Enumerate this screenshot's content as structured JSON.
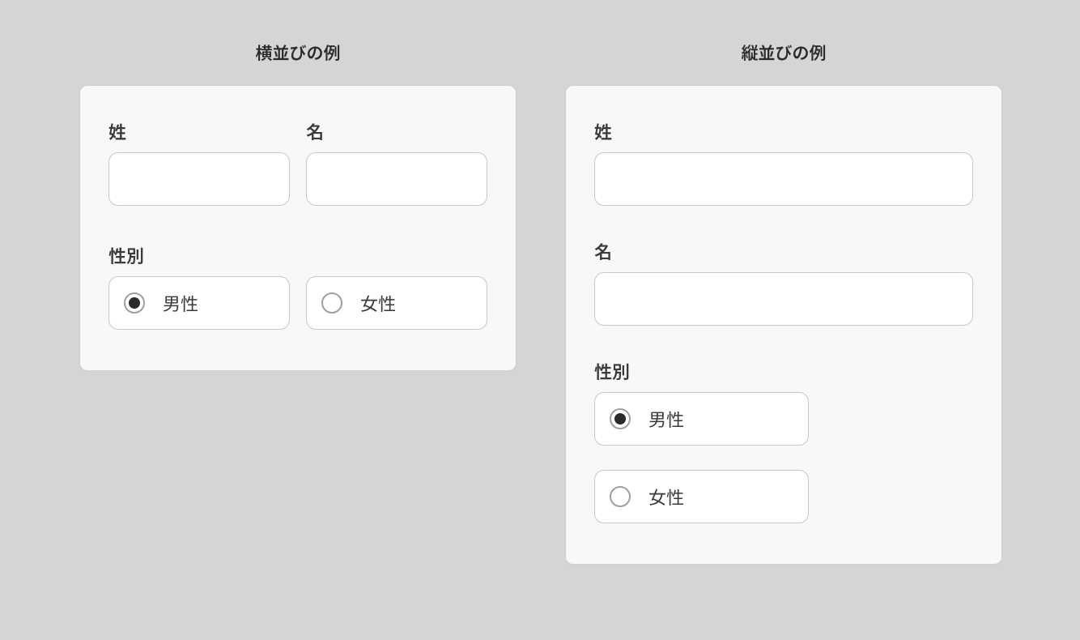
{
  "horizontal": {
    "title": "横並びの例",
    "fields": {
      "lastName": "姓",
      "firstName": "名",
      "gender": "性別"
    },
    "radios": {
      "male": "男性",
      "female": "女性"
    },
    "selected": "male"
  },
  "vertical": {
    "title": "縦並びの例",
    "fields": {
      "lastName": "姓",
      "firstName": "名",
      "gender": "性別"
    },
    "radios": {
      "male": "男性",
      "female": "女性"
    },
    "selected": "male"
  }
}
